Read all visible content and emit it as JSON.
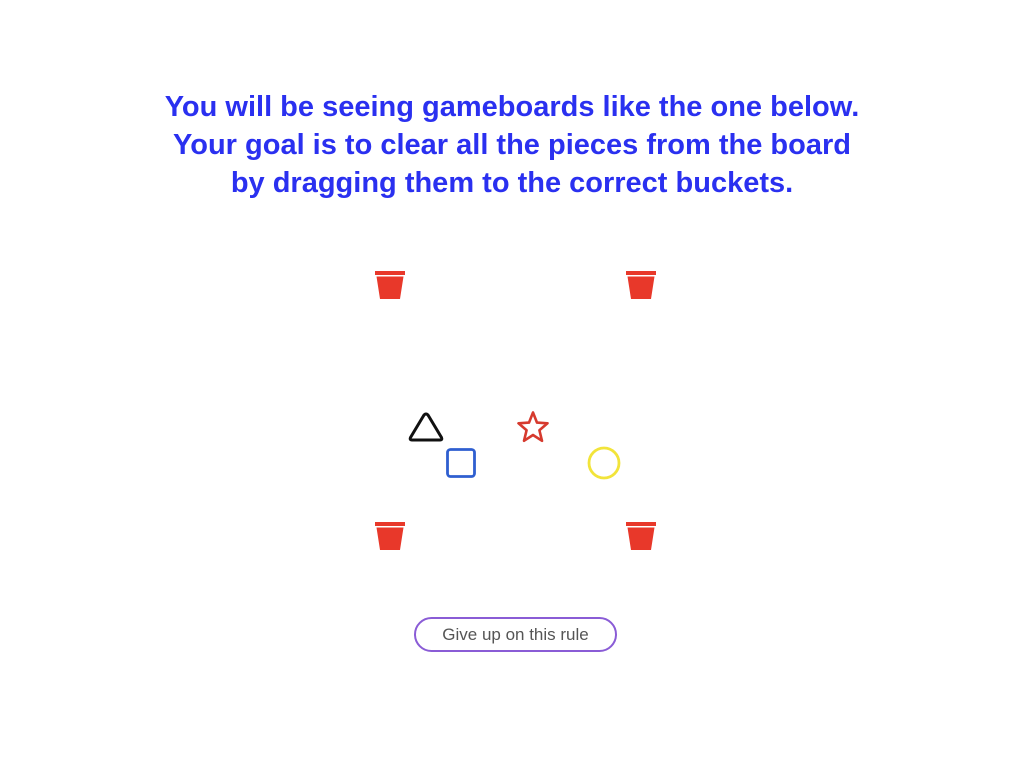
{
  "instructions": {
    "line1": "You will be seeing gameboards like the one below.",
    "line2": "Your goal is to clear all the pieces from the board",
    "line3": "by dragging them to the correct buckets."
  },
  "colors": {
    "text": "#2a30f0",
    "bucket": "#e8382a",
    "triangle": "#111111",
    "star": "#d63a2e",
    "square": "#2f5fd0",
    "circle": "#f2e43a",
    "button_border": "#8a5cd6"
  },
  "buckets": [
    {
      "name": "bucket-top-left",
      "icon": "bucket-icon"
    },
    {
      "name": "bucket-top-right",
      "icon": "bucket-icon"
    },
    {
      "name": "bucket-bottom-left",
      "icon": "bucket-icon"
    },
    {
      "name": "bucket-bottom-right",
      "icon": "bucket-icon"
    }
  ],
  "pieces": [
    {
      "shape": "triangle",
      "color": "black"
    },
    {
      "shape": "star",
      "color": "red"
    },
    {
      "shape": "square",
      "color": "blue"
    },
    {
      "shape": "circle",
      "color": "yellow"
    }
  ],
  "give_up_label": "Give up on this rule"
}
